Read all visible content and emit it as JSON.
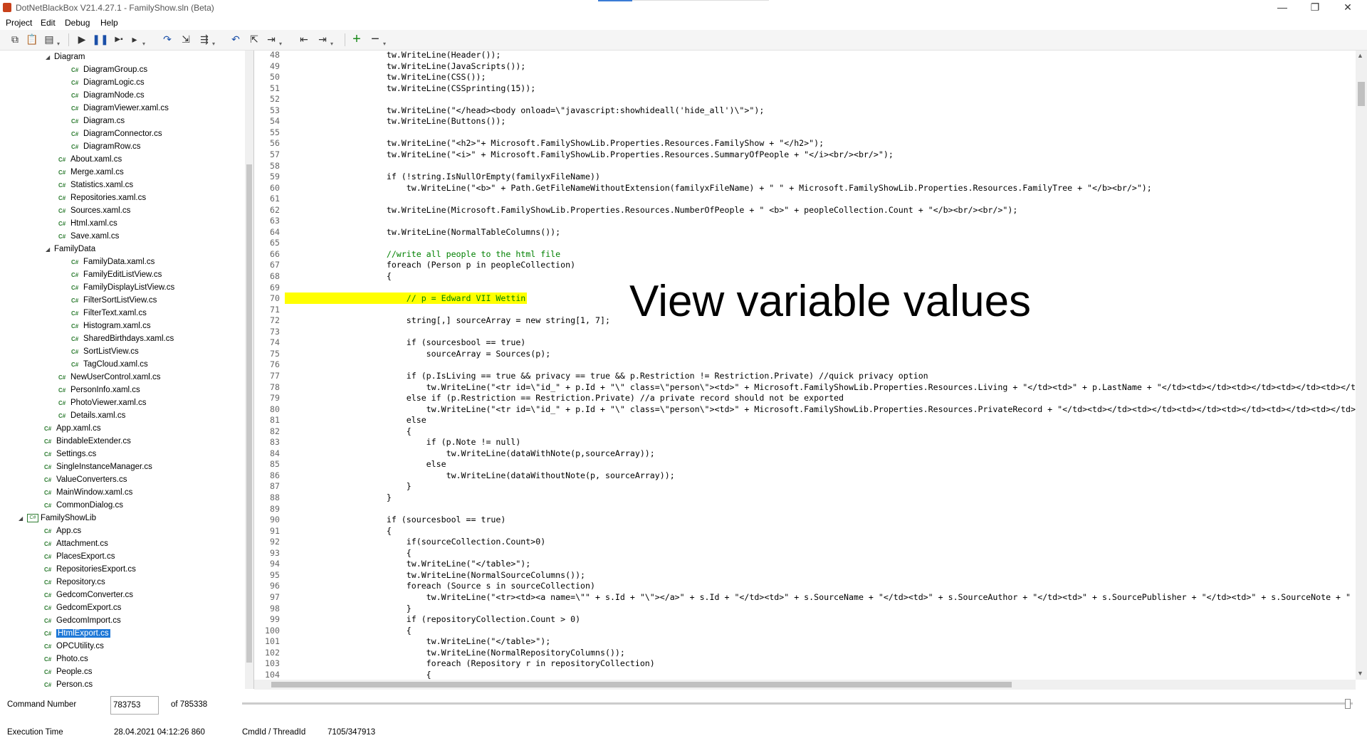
{
  "window": {
    "title": "DotNetBlackBox V21.4.27.1 - FamilyShow.sln (Beta)",
    "minimize": "—",
    "maximize": "❐",
    "close": "✕"
  },
  "menu": [
    "Project",
    "Edit",
    "Debug",
    "Help"
  ],
  "toolbar_icons": [
    "copy-icon",
    "paste-icon",
    "open-icon",
    "play-icon",
    "pause-icon",
    "step-icon",
    "step-over-icon",
    "step-into-icon",
    "step-out-icon",
    "undo-icon",
    "goto-icon",
    "run-to-icon",
    "indent-icon",
    "outdent-icon",
    "add-icon",
    "remove-icon"
  ],
  "tree": {
    "selected": "HtmlExport.cs",
    "items": [
      {
        "label": "Diagram",
        "type": "folder",
        "indent": 1,
        "expanded": true
      },
      {
        "label": "DiagramGroup.cs",
        "type": "cs",
        "indent": 2
      },
      {
        "label": "DiagramLogic.cs",
        "type": "cs",
        "indent": 2
      },
      {
        "label": "DiagramNode.cs",
        "type": "cs",
        "indent": 2
      },
      {
        "label": "DiagramViewer.xaml.cs",
        "type": "cs",
        "indent": 2
      },
      {
        "label": "Diagram.cs",
        "type": "cs",
        "indent": 2
      },
      {
        "label": "DiagramConnector.cs",
        "type": "cs",
        "indent": 2
      },
      {
        "label": "DiagramRow.cs",
        "type": "cs",
        "indent": 2
      },
      {
        "label": "About.xaml.cs",
        "type": "cs",
        "indent": 1
      },
      {
        "label": "Merge.xaml.cs",
        "type": "cs",
        "indent": 1
      },
      {
        "label": "Statistics.xaml.cs",
        "type": "cs",
        "indent": 1
      },
      {
        "label": "Repositories.xaml.cs",
        "type": "cs",
        "indent": 1
      },
      {
        "label": "Sources.xaml.cs",
        "type": "cs",
        "indent": 1
      },
      {
        "label": "Html.xaml.cs",
        "type": "cs",
        "indent": 1
      },
      {
        "label": "Save.xaml.cs",
        "type": "cs",
        "indent": 1
      },
      {
        "label": "FamilyData",
        "type": "folder",
        "indent": 1,
        "expanded": true
      },
      {
        "label": "FamilyData.xaml.cs",
        "type": "cs",
        "indent": 2
      },
      {
        "label": "FamilyEditListView.cs",
        "type": "cs",
        "indent": 2
      },
      {
        "label": "FamilyDisplayListView.cs",
        "type": "cs",
        "indent": 2
      },
      {
        "label": "FilterSortListView.cs",
        "type": "cs",
        "indent": 2
      },
      {
        "label": "FilterText.xaml.cs",
        "type": "cs",
        "indent": 2
      },
      {
        "label": "Histogram.xaml.cs",
        "type": "cs",
        "indent": 2
      },
      {
        "label": "SharedBirthdays.xaml.cs",
        "type": "cs",
        "indent": 2
      },
      {
        "label": "SortListView.cs",
        "type": "cs",
        "indent": 2
      },
      {
        "label": "TagCloud.xaml.cs",
        "type": "cs",
        "indent": 2
      },
      {
        "label": "NewUserControl.xaml.cs",
        "type": "cs",
        "indent": 1
      },
      {
        "label": "PersonInfo.xaml.cs",
        "type": "cs",
        "indent": 1
      },
      {
        "label": "PhotoViewer.xaml.cs",
        "type": "cs",
        "indent": 1
      },
      {
        "label": "Details.xaml.cs",
        "type": "cs",
        "indent": 1
      },
      {
        "label": "App.xaml.cs",
        "type": "cs",
        "indent": 0
      },
      {
        "label": "BindableExtender.cs",
        "type": "cs",
        "indent": 0
      },
      {
        "label": "Settings.cs",
        "type": "cs",
        "indent": 0
      },
      {
        "label": "SingleInstanceManager.cs",
        "type": "cs",
        "indent": 0
      },
      {
        "label": "ValueConverters.cs",
        "type": "cs",
        "indent": 0
      },
      {
        "label": "MainWindow.xaml.cs",
        "type": "cs",
        "indent": 0
      },
      {
        "label": "CommonDialog.cs",
        "type": "cs",
        "indent": 0
      },
      {
        "label": "FamilyShowLib",
        "type": "project",
        "indent": -1,
        "expanded": true
      },
      {
        "label": "App.cs",
        "type": "cs",
        "indent": 0
      },
      {
        "label": "Attachment.cs",
        "type": "cs",
        "indent": 0
      },
      {
        "label": "PlacesExport.cs",
        "type": "cs",
        "indent": 0
      },
      {
        "label": "RepositoriesExport.cs",
        "type": "cs",
        "indent": 0
      },
      {
        "label": "Repository.cs",
        "type": "cs",
        "indent": 0
      },
      {
        "label": "GedcomConverter.cs",
        "type": "cs",
        "indent": 0
      },
      {
        "label": "GedcomExport.cs",
        "type": "cs",
        "indent": 0
      },
      {
        "label": "GedcomImport.cs",
        "type": "cs",
        "indent": 0
      },
      {
        "label": "HtmlExport.cs",
        "type": "cs",
        "indent": 0,
        "selected": true
      },
      {
        "label": "OPCUtility.cs",
        "type": "cs",
        "indent": 0
      },
      {
        "label": "Photo.cs",
        "type": "cs",
        "indent": 0
      },
      {
        "label": "People.cs",
        "type": "cs",
        "indent": 0
      },
      {
        "label": "Person.cs",
        "type": "cs",
        "indent": 0
      }
    ]
  },
  "code_lines": [
    {
      "n": "48",
      "text": "        tw.WriteLine(Header());"
    },
    {
      "n": "49",
      "text": "        tw.WriteLine(JavaScripts());"
    },
    {
      "n": "50",
      "text": "        tw.WriteLine(CSS());"
    },
    {
      "n": "51",
      "text": "        tw.WriteLine(CSSprinting(15));"
    },
    {
      "n": "52",
      "text": ""
    },
    {
      "n": "53",
      "text": "        tw.WriteLine(\"</head><body onload=\\\"javascript:showhideall('hide_all')\\\">\");"
    },
    {
      "n": "54",
      "text": "        tw.WriteLine(Buttons());"
    },
    {
      "n": "55",
      "text": ""
    },
    {
      "n": "56",
      "text": "        tw.WriteLine(\"<h2>\"+ Microsoft.FamilyShowLib.Properties.Resources.FamilyShow + \"</h2>\");"
    },
    {
      "n": "57",
      "text": "        tw.WriteLine(\"<i>\" + Microsoft.FamilyShowLib.Properties.Resources.SummaryOfPeople + \"</i><br/><br/>\");"
    },
    {
      "n": "58",
      "text": ""
    },
    {
      "n": "59",
      "text": "        if (!string.IsNullOrEmpty(familyxFileName))"
    },
    {
      "n": "60",
      "text": "            tw.WriteLine(\"<b>\" + Path.GetFileNameWithoutExtension(familyxFileName) + \" \" + Microsoft.FamilyShowLib.Properties.Resources.FamilyTree + \"</b><br/>\");"
    },
    {
      "n": "61",
      "text": ""
    },
    {
      "n": "62",
      "text": "        tw.WriteLine(Microsoft.FamilyShowLib.Properties.Resources.NumberOfPeople + \" <b>\" + peopleCollection.Count + \"</b><br/><br/>\");"
    },
    {
      "n": "63",
      "text": ""
    },
    {
      "n": "64",
      "text": "        tw.WriteLine(NormalTableColumns());"
    },
    {
      "n": "65",
      "text": ""
    },
    {
      "n": "66",
      "text": "        //write all people to the html file"
    },
    {
      "n": "67",
      "text": "        foreach (Person p in peopleCollection)"
    },
    {
      "n": "68",
      "text": "        {"
    },
    {
      "n": "69",
      "text": ""
    },
    {
      "n": "70",
      "text": "            // p = Edward VII Wettin",
      "highlight": true
    },
    {
      "n": "71",
      "text": ""
    },
    {
      "n": "72",
      "text": "            string[,] sourceArray = new string[1, 7];"
    },
    {
      "n": "73",
      "text": ""
    },
    {
      "n": "74",
      "text": "            if (sourcesbool == true)"
    },
    {
      "n": "75",
      "text": "                sourceArray = Sources(p);"
    },
    {
      "n": "76",
      "text": ""
    },
    {
      "n": "77",
      "text": "            if (p.IsLiving == true && privacy == true && p.Restriction != Restriction.Private) //quick privacy option"
    },
    {
      "n": "78",
      "text": "                tw.WriteLine(\"<tr id=\\\"id_\" + p.Id + \"\\\" class=\\\"person\\\"><td>\" + Microsoft.FamilyShowLib.Properties.Resources.Living + \"</td><td>\" + p.LastName + \"</td><td></td><td></td><td></td><td></td><td></td>"
    },
    {
      "n": "79",
      "text": "            else if (p.Restriction == Restriction.Private) //a private record should not be exported"
    },
    {
      "n": "80",
      "text": "                tw.WriteLine(\"<tr id=\\\"id_\" + p.Id + \"\\\" class=\\\"person\\\"><td>\" + Microsoft.FamilyShowLib.Properties.Resources.PrivateRecord + \"</td><td></td><td></td><td></td><td></td><td></td><td></td><td></td><td>"
    },
    {
      "n": "81",
      "text": "            else"
    },
    {
      "n": "82",
      "text": "            {"
    },
    {
      "n": "83",
      "text": "                if (p.Note != null)"
    },
    {
      "n": "84",
      "text": "                    tw.WriteLine(dataWithNote(p,sourceArray));"
    },
    {
      "n": "85",
      "text": "                else"
    },
    {
      "n": "86",
      "text": "                    tw.WriteLine(dataWithoutNote(p, sourceArray));"
    },
    {
      "n": "87",
      "text": "            }"
    },
    {
      "n": "88",
      "text": "        }"
    },
    {
      "n": "89",
      "text": ""
    },
    {
      "n": "90",
      "text": "        if (sourcesbool == true)"
    },
    {
      "n": "91",
      "text": "        {"
    },
    {
      "n": "92",
      "text": "            if(sourceCollection.Count>0)"
    },
    {
      "n": "93",
      "text": "            {"
    },
    {
      "n": "94",
      "text": "            tw.WriteLine(\"</table>\");"
    },
    {
      "n": "95",
      "text": "            tw.WriteLine(NormalSourceColumns());"
    },
    {
      "n": "96",
      "text": "            foreach (Source s in sourceCollection)"
    },
    {
      "n": "97",
      "text": "                tw.WriteLine(\"<tr><td><a name=\\\"\" + s.Id + \"\\\"></a>\" + s.Id + \"</td><td>\" + s.SourceName + \"</td><td>\" + s.SourceAuthor + \"</td><td>\" + s.SourcePublisher + \"</td><td>\" + s.SourceNote + \""
    },
    {
      "n": "98",
      "text": "            }"
    },
    {
      "n": "99",
      "text": "            if (repositoryCollection.Count > 0)"
    },
    {
      "n": "100",
      "text": "            {"
    },
    {
      "n": "101",
      "text": "                tw.WriteLine(\"</table>\");"
    },
    {
      "n": "102",
      "text": "                tw.WriteLine(NormalRepositoryColumns());"
    },
    {
      "n": "103",
      "text": "                foreach (Repository r in repositoryCollection)"
    },
    {
      "n": "104",
      "text": "                {"
    }
  ],
  "overlay_text": "View variable values",
  "status": {
    "command_number_label": "Command Number",
    "command_number_value": "783753",
    "of_total": "of 785338",
    "execution_time_label": "Execution Time",
    "execution_time_value": "28.04.2021 04:12:26 860",
    "cmdid_label": "CmdId / ThreadId",
    "cmdid_value": "7105/347913",
    "slider_position": 0.998
  },
  "colors": {
    "highlight": "#ffff00",
    "keyword": "#0000ff",
    "string": "#a31515",
    "comment": "#008000",
    "selection": "#1e78d7"
  }
}
